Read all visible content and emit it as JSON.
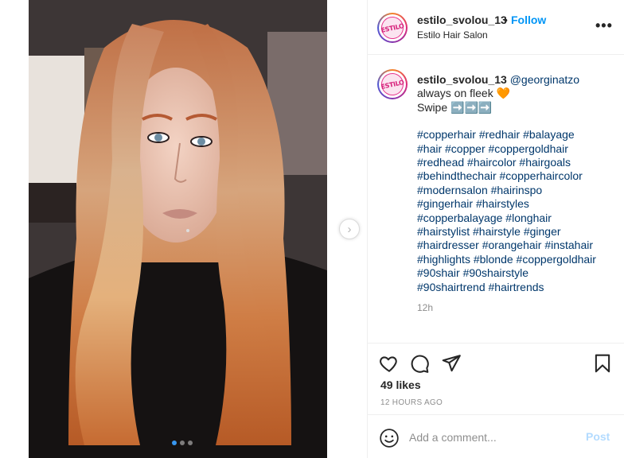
{
  "post": {
    "username": "estilo_svolou_13",
    "follow_label": "Follow",
    "separator": "•",
    "location": "Estilo Hair Salon",
    "more_label": "•••",
    "avatar_text": "ESTILO"
  },
  "caption": {
    "username": "estilo_svolou_13",
    "mention": "@georginatzo",
    "line1": "always on fleek 🧡",
    "line2": "Swipe ➡️➡️➡️",
    "hashtag_lines": [
      "#copperhair #redhair #balayage",
      "#hair #copper #coppergoldhair",
      "#redhead #haircolor #hairgoals",
      "#behindthechair #copperhaircolor",
      "#modernsalon #hairinspo",
      "#gingerhair #hairstyles",
      "#copperbalayage #longhair",
      "#hairstylist #hairstyle #ginger",
      "#hairdresser #orangehair #instahair",
      "#highlights #blonde #coppergoldhair",
      "#90shair #90shairstyle",
      "#90shairtrend #hairtrends"
    ],
    "time": "12h"
  },
  "media": {
    "next_arrow": "›",
    "slide_count": 3,
    "active_slide": 1
  },
  "engagement": {
    "likes": "49 likes",
    "posted": "12 HOURS AGO"
  },
  "comment": {
    "placeholder": "Add a comment...",
    "post_label": "Post"
  },
  "icons": {
    "like": "heart-icon",
    "comment": "comment-icon",
    "share": "paper-plane-icon",
    "save": "bookmark-icon",
    "emoji": "smiley-icon"
  },
  "colors": {
    "link": "#00376b",
    "follow": "#0095f6",
    "post_disabled": "#b3dbff",
    "muted": "#8e8e8e"
  }
}
